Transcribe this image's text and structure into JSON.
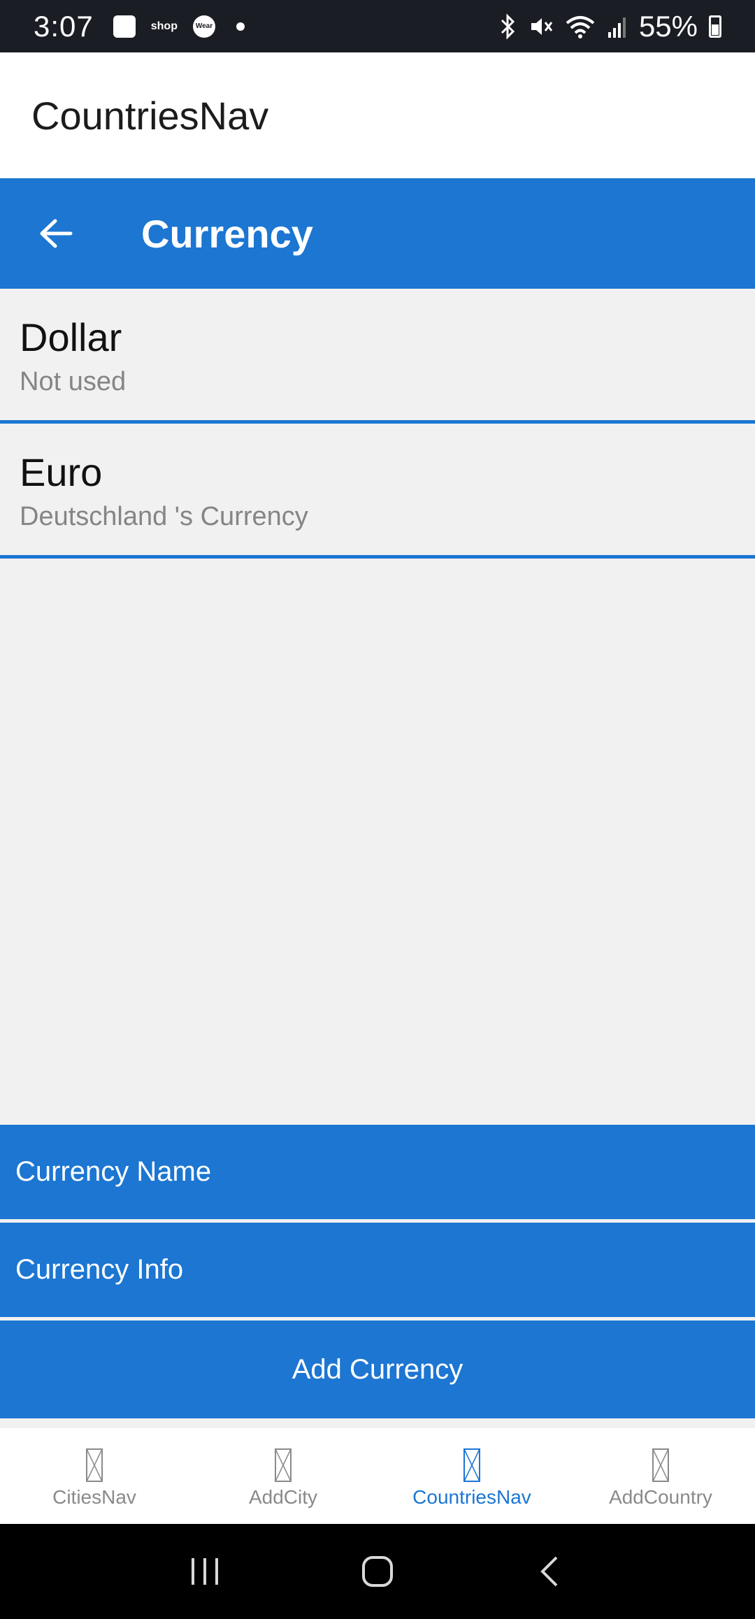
{
  "status_bar": {
    "time": "3:07",
    "notification_icons": [
      "gallery-icon",
      "shop-icon",
      "wear-icon"
    ],
    "shop_text": "shop",
    "wear_text": "Wear",
    "battery_percent": "55%"
  },
  "app": {
    "title": "CountriesNav"
  },
  "header": {
    "title": "Currency",
    "back_icon": "arrow-left-icon"
  },
  "currencies": [
    {
      "name": "Dollar",
      "info": "Not used"
    },
    {
      "name": "Euro",
      "info": "Deutschland 's Currency"
    }
  ],
  "form": {
    "name_placeholder": "Currency Name",
    "info_placeholder": "Currency Info",
    "add_button_label": "Add Currency"
  },
  "tabs": [
    {
      "label": "CitiesNav",
      "active": false
    },
    {
      "label": "AddCity",
      "active": false
    },
    {
      "label": "CountriesNav",
      "active": true
    },
    {
      "label": "AddCountry",
      "active": false
    }
  ],
  "colors": {
    "primary": "#1c76d2",
    "background": "#f1f1f1",
    "status_bar": "#1b1d24",
    "inactive_tab": "#8a8a8a"
  }
}
